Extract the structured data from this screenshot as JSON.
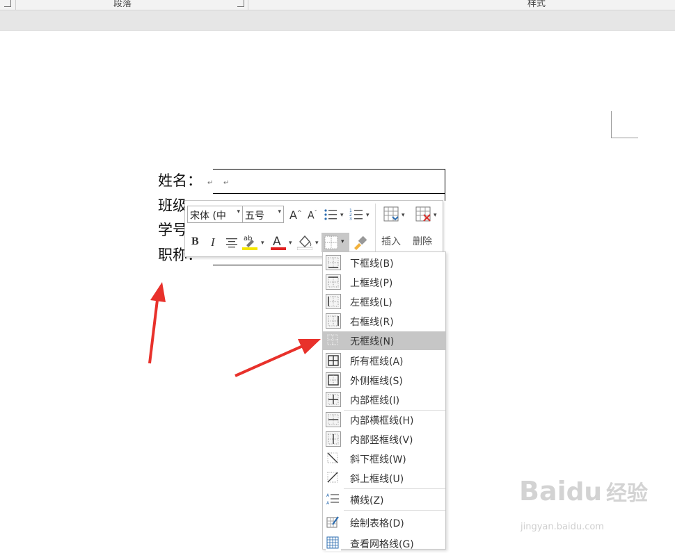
{
  "ribbon": {
    "paragraph_group": "段落",
    "styles_group": "样式"
  },
  "document": {
    "lines": [
      "姓名：",
      "班级",
      "学号",
      "职称："
    ]
  },
  "mini_toolbar": {
    "font_name": "宋体 (中",
    "font_size": "五号",
    "bold": "B",
    "italic": "I",
    "insert_label": "插入",
    "delete_label": "删除"
  },
  "border_menu": {
    "items": [
      {
        "label": "下框线(B)",
        "icon": "bottom-border-icon"
      },
      {
        "label": "上框线(P)",
        "icon": "top-border-icon"
      },
      {
        "label": "左框线(L)",
        "icon": "left-border-icon"
      },
      {
        "label": "右框线(R)",
        "icon": "right-border-icon"
      },
      {
        "label": "无框线(N)",
        "icon": "no-border-icon",
        "highlighted": true
      },
      {
        "label": "所有框线(A)",
        "icon": "all-borders-icon"
      },
      {
        "label": "外侧框线(S)",
        "icon": "outside-borders-icon"
      },
      {
        "label": "内部框线(I)",
        "icon": "inside-borders-icon"
      },
      {
        "label": "内部横框线(H)",
        "icon": "inside-horizontal-border-icon"
      },
      {
        "label": "内部竖框线(V)",
        "icon": "inside-vertical-border-icon"
      },
      {
        "label": "斜下框线(W)",
        "icon": "diagonal-down-border-icon"
      },
      {
        "label": "斜上框线(U)",
        "icon": "diagonal-up-border-icon"
      },
      {
        "label": "横线(Z)",
        "icon": "horizontal-line-icon"
      },
      {
        "label": "绘制表格(D)",
        "icon": "draw-table-icon"
      },
      {
        "label": "查看网格线(G)",
        "icon": "view-gridlines-icon"
      }
    ]
  },
  "colors": {
    "highlight": "#f5e600",
    "font_color": "#e02020",
    "arrow": "#e8312b",
    "menu_highlight": "#c6c6c6"
  },
  "watermark": {
    "brand": "Bai",
    "brand_cn": "经验",
    "url": "jingyan.baidu.com"
  }
}
